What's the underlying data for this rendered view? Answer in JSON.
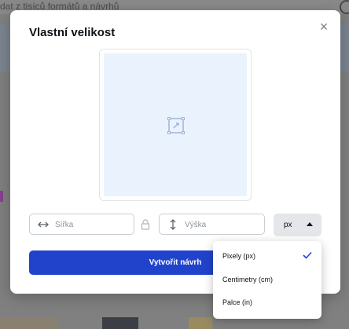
{
  "background": {
    "search_text": "dat z tisíců formátů a návrhů"
  },
  "modal": {
    "title": "Vlastní velikost",
    "close_label": "×"
  },
  "fields": {
    "width_placeholder": "Šířka",
    "height_placeholder": "Výška"
  },
  "unit_select": {
    "value": "px"
  },
  "create_button": {
    "label": "Vytvořit návrh"
  },
  "unit_dropdown": {
    "options": [
      {
        "label": "Pixely (px)",
        "selected": true
      },
      {
        "label": "Centimetry (cm)",
        "selected": false
      },
      {
        "label": "Palce (in)",
        "selected": false
      }
    ]
  },
  "colors": {
    "accent": "#2143cc",
    "preview_fill": "#eaf2fd",
    "overlay": "#808080"
  },
  "icons": {
    "width_field": "horizontal-arrow-icon",
    "height_field": "vertical-arrow-icon",
    "ratio_lock": "lock-icon",
    "preview": "resize-icon",
    "selected_option": "check-icon"
  }
}
